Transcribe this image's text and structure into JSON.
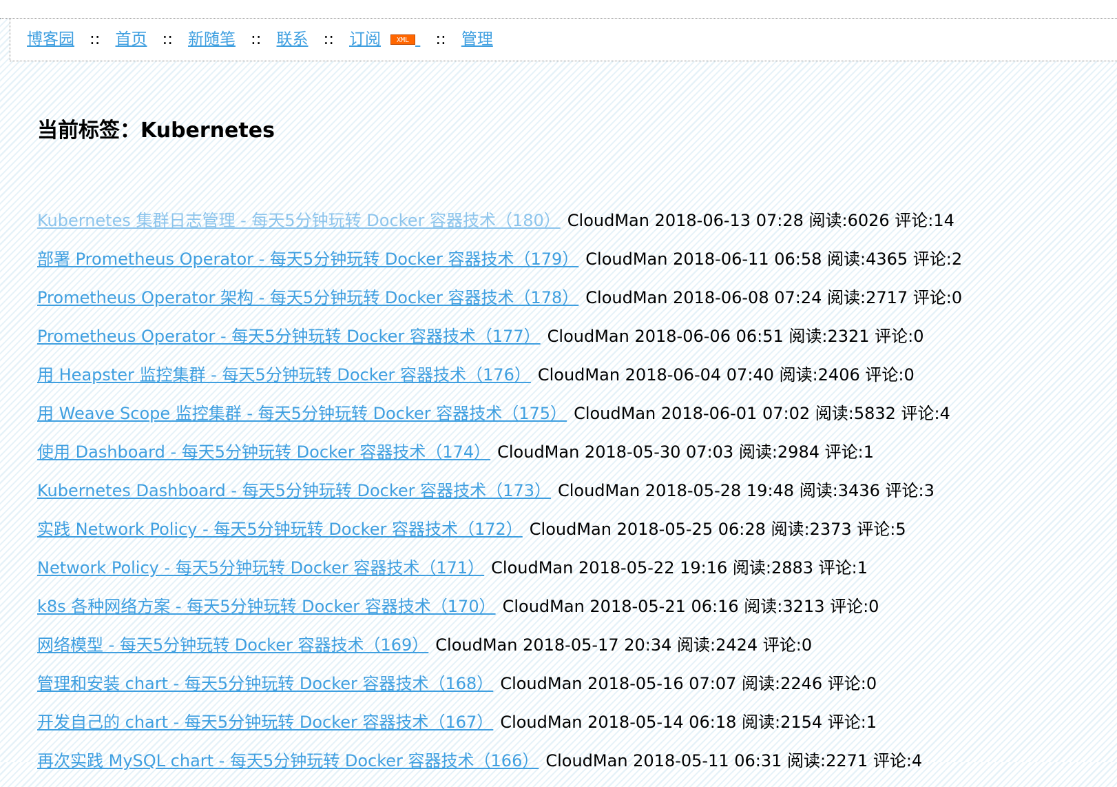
{
  "nav": {
    "home_site": "博客园",
    "home": "首页",
    "new_post": "新随笔",
    "contact": "联系",
    "subscribe": "订阅",
    "xml_badge": "XML",
    "manage": "管理",
    "sep": "::"
  },
  "page": {
    "title": "当前标签：Kubernetes"
  },
  "posts": [
    {
      "title": "Kubernetes 集群日志管理 - 每天5分钟玩转 Docker 容器技术（180）",
      "meta": "CloudMan 2018-06-13 07:28 阅读:6026 评论:14"
    },
    {
      "title": "部署 Prometheus Operator - 每天5分钟玩转 Docker 容器技术（179）",
      "meta": "CloudMan 2018-06-11 06:58 阅读:4365 评论:2"
    },
    {
      "title": "Prometheus Operator 架构 - 每天5分钟玩转 Docker 容器技术（178）",
      "meta": "CloudMan 2018-06-08 07:24 阅读:2717 评论:0"
    },
    {
      "title": "Prometheus Operator - 每天5分钟玩转 Docker 容器技术（177）",
      "meta": "CloudMan 2018-06-06 06:51 阅读:2321 评论:0"
    },
    {
      "title": "用 Heapster 监控集群 - 每天5分钟玩转 Docker 容器技术（176）",
      "meta": "CloudMan 2018-06-04 07:40 阅读:2406 评论:0"
    },
    {
      "title": "用 Weave Scope 监控集群 - 每天5分钟玩转 Docker 容器技术（175）",
      "meta": "CloudMan 2018-06-01 07:02 阅读:5832 评论:4"
    },
    {
      "title": "使用 Dashboard - 每天5分钟玩转 Docker 容器技术（174）",
      "meta": "CloudMan 2018-05-30 07:03 阅读:2984 评论:1"
    },
    {
      "title": "Kubernetes Dashboard - 每天5分钟玩转 Docker 容器技术（173）",
      "meta": "CloudMan 2018-05-28 19:48 阅读:3436 评论:3"
    },
    {
      "title": "实践 Network Policy - 每天5分钟玩转 Docker 容器技术（172）",
      "meta": "CloudMan 2018-05-25 06:28 阅读:2373 评论:5"
    },
    {
      "title": "Network Policy - 每天5分钟玩转 Docker 容器技术（171）",
      "meta": "CloudMan 2018-05-22 19:16 阅读:2883 评论:1"
    },
    {
      "title": "k8s 各种网络方案 - 每天5分钟玩转 Docker 容器技术（170）",
      "meta": "CloudMan 2018-05-21 06:16 阅读:3213 评论:0"
    },
    {
      "title": "网络模型 - 每天5分钟玩转 Docker 容器技术（169）",
      "meta": "CloudMan 2018-05-17 20:34 阅读:2424 评论:0"
    },
    {
      "title": "管理和安装 chart - 每天5分钟玩转 Docker 容器技术（168）",
      "meta": "CloudMan 2018-05-16 07:07 阅读:2246 评论:0"
    },
    {
      "title": "开发自己的 chart - 每天5分钟玩转 Docker 容器技术（167）",
      "meta": "CloudMan 2018-05-14 06:18 阅读:2154 评论:1"
    },
    {
      "title": "再次实践 MySQL chart - 每天5分钟玩转 Docker 容器技术（166）",
      "meta": "CloudMan 2018-05-11 06:31 阅读:2271 评论:4"
    }
  ],
  "colors": {
    "link": "#3f9fe0",
    "visited_link": "#8cc4ec",
    "xml_badge_bg": "#ff6600"
  }
}
